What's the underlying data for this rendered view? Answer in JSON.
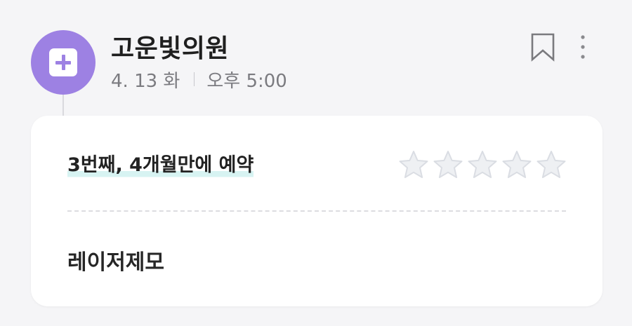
{
  "record": {
    "clinic_name": "고운빛의원",
    "date": "4. 13 화",
    "time": "오후 5:00",
    "visit_info": "3번째, 4개월만에 예약",
    "treatment": "레이저제모",
    "rating": 0,
    "rating_max": 5
  },
  "icons": {
    "place": "hospital-plus-icon",
    "bookmark": "bookmark-icon",
    "more": "more-vertical-icon",
    "star": "star-icon"
  },
  "colors": {
    "accent": "#9d81e3",
    "highlight": "#d7f3f2",
    "star_empty": "#eef0f3",
    "star_outline": "#dadde3",
    "text_primary": "#1f1f1f",
    "text_secondary": "#7b7b80"
  }
}
